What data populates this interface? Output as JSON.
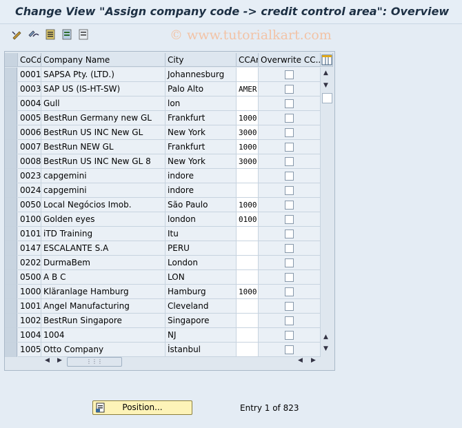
{
  "title": "Change View \"Assign company code -> credit control area\": Overview",
  "watermark": "© www.tutorialkart.com",
  "toolbar": {
    "icons": [
      "display-change-icon",
      "other-view-icon",
      "save-icon",
      "select-all-icon",
      "deselect-icon"
    ]
  },
  "table": {
    "columns": [
      "CoCd",
      "Company Name",
      "City",
      "CCAr",
      "Overwrite CC..."
    ],
    "rows": [
      {
        "cocd": "0001",
        "name": "SAPSA Pty. (LTD.)",
        "city": "Johannesburg",
        "ccar": "",
        "overwrite": false
      },
      {
        "cocd": "0003",
        "name": "SAP US (IS-HT-SW)",
        "city": "Palo Alto",
        "ccar": "AMER",
        "overwrite": false
      },
      {
        "cocd": "0004",
        "name": "Gull",
        "city": "lon",
        "ccar": "",
        "overwrite": false
      },
      {
        "cocd": "0005",
        "name": "BestRun Germany new GL",
        "city": "Frankfurt",
        "ccar": "1000",
        "overwrite": false
      },
      {
        "cocd": "0006",
        "name": "BestRun US INC New GL",
        "city": "New York",
        "ccar": "3000",
        "overwrite": false
      },
      {
        "cocd": "0007",
        "name": "BestRun NEW GL",
        "city": "Frankfurt",
        "ccar": "1000",
        "overwrite": false
      },
      {
        "cocd": "0008",
        "name": "BestRun US INC New GL 8",
        "city": "New York",
        "ccar": "3000",
        "overwrite": false
      },
      {
        "cocd": "0023",
        "name": "capgemini",
        "city": "indore",
        "ccar": "",
        "overwrite": false
      },
      {
        "cocd": "0024",
        "name": "capgemini",
        "city": "indore",
        "ccar": "",
        "overwrite": false
      },
      {
        "cocd": "0050",
        "name": "Local Negócios Imob.",
        "city": "São Paulo",
        "ccar": "1000",
        "overwrite": false
      },
      {
        "cocd": "0100",
        "name": "Golden eyes",
        "city": "london",
        "ccar": "0100",
        "overwrite": false
      },
      {
        "cocd": "0101",
        "name": "iTD Training",
        "city": "Itu",
        "ccar": "",
        "overwrite": false
      },
      {
        "cocd": "0147",
        "name": "ESCALANTE S.A",
        "city": "PERU",
        "ccar": "",
        "overwrite": false
      },
      {
        "cocd": "0202",
        "name": "DurmaBem",
        "city": "London",
        "ccar": "",
        "overwrite": false
      },
      {
        "cocd": "0500",
        "name": "A B C",
        "city": "LON",
        "ccar": "",
        "overwrite": false
      },
      {
        "cocd": "1000",
        "name": "Kläranlage Hamburg",
        "city": "Hamburg",
        "ccar": "1000",
        "overwrite": false
      },
      {
        "cocd": "1001",
        "name": "Angel Manufacturing",
        "city": "Cleveland",
        "ccar": "",
        "overwrite": false
      },
      {
        "cocd": "1002",
        "name": "BestRun Singapore",
        "city": "Singapore",
        "ccar": "",
        "overwrite": false
      },
      {
        "cocd": "1004",
        "name": "1004",
        "city": "NJ",
        "ccar": "",
        "overwrite": false
      },
      {
        "cocd": "1005",
        "name": "Otto Company",
        "city": "İstanbul",
        "ccar": "",
        "overwrite": false
      }
    ]
  },
  "position_button": "Position...",
  "entry_text": "Entry 1 of 823"
}
